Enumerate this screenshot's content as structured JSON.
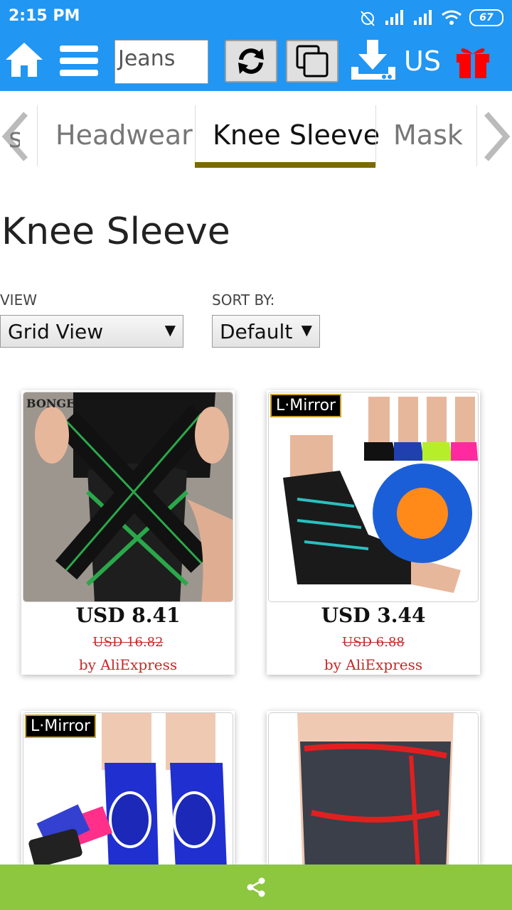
{
  "status_bar": {
    "time": "2:15 PM",
    "battery": "67"
  },
  "toolbar": {
    "search_value": "Jeans",
    "language": "US"
  },
  "tabs": [
    {
      "label": "Headwear",
      "active": false
    },
    {
      "label": "Knee Sleeve",
      "active": true
    },
    {
      "label": "Mask",
      "active": false
    }
  ],
  "tab_partial_left": "s",
  "page": {
    "title": "Knee Sleeve",
    "view_label": "VIEW",
    "view_value": "Grid View",
    "sort_label": "SORT BY:",
    "sort_value": "Default"
  },
  "products": [
    {
      "brand": "BONGE",
      "price": "USD 8.41",
      "old_price": "USD 16.82",
      "seller": "by AliExpress"
    },
    {
      "brand": "L·Mirror",
      "price": "USD 3.44",
      "old_price": "USD 6.88",
      "seller": "by AliExpress"
    },
    {
      "brand": "L·Mirror"
    },
    {
      "brand": ""
    }
  ],
  "colors": {
    "primary": "#2196f3",
    "accent_underline": "#7a6a00",
    "price_red": "#c62828",
    "share_bar": "#8dc63f"
  }
}
